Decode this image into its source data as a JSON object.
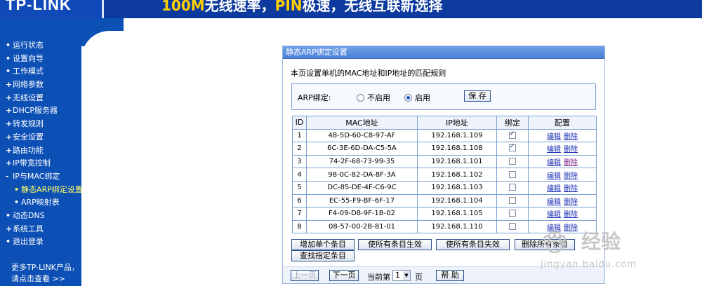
{
  "banner": {
    "logo": "TP-LINK",
    "slogan_a": "100M",
    "slogan_b": "无线速率，",
    "slogan_c": "PIN",
    "slogan_d": "极速，无线互联新选择"
  },
  "sidebar": {
    "items": [
      {
        "bullet": "•",
        "label": "运行状态"
      },
      {
        "bullet": "•",
        "label": "设置向导"
      },
      {
        "bullet": "•",
        "label": "工作模式"
      },
      {
        "bullet": "+",
        "label": "网络参数"
      },
      {
        "bullet": "+",
        "label": "无线设置"
      },
      {
        "bullet": "+",
        "label": "DHCP服务器"
      },
      {
        "bullet": "+",
        "label": "转发规则"
      },
      {
        "bullet": "+",
        "label": "安全设置"
      },
      {
        "bullet": "+",
        "label": "路由功能"
      },
      {
        "bullet": "+",
        "label": "IP带宽控制"
      },
      {
        "bullet": "-",
        "label": "IP与MAC绑定"
      },
      {
        "bullet": "•",
        "label": "静态ARP绑定设置"
      },
      {
        "bullet": "•",
        "label": "ARP映射表"
      },
      {
        "bullet": "•",
        "label": "动态DNS"
      },
      {
        "bullet": "+",
        "label": "系统工具"
      },
      {
        "bullet": "•",
        "label": "退出登录"
      }
    ],
    "promo_line1": "更多TP-LINK产品，",
    "promo_line2": "请点击查看 >>"
  },
  "panel": {
    "title": "静态ARP绑定设置",
    "description": "本页设置单机的MAC地址和IP地址的匹配规则",
    "arp_bind_label": "ARP绑定:",
    "radio_off": "不启用",
    "radio_on": "启用",
    "save_label": "保 存",
    "table": {
      "headers": [
        "ID",
        "MAC地址",
        "IP地址",
        "绑定",
        "配置"
      ],
      "edit_label": "编辑",
      "delete_label": "删除",
      "rows": [
        {
          "id": "1",
          "mac": "48-5D-60-C8-97-AF",
          "ip": "192.168.1.109",
          "bound": true
        },
        {
          "id": "2",
          "mac": "6C-3E-6D-DA-C5-5A",
          "ip": "192.168.1.108",
          "bound": true
        },
        {
          "id": "3",
          "mac": "74-2F-68-73-99-35",
          "ip": "192.168.1.101",
          "bound": false
        },
        {
          "id": "4",
          "mac": "98-0C-82-DA-8F-3A",
          "ip": "192.168.1.102",
          "bound": false
        },
        {
          "id": "5",
          "mac": "DC-85-DE-4F-C6-9C",
          "ip": "192.168.1.103",
          "bound": false
        },
        {
          "id": "6",
          "mac": "EC-55-F9-BF-6F-17",
          "ip": "192.168.1.104",
          "bound": false
        },
        {
          "id": "7",
          "mac": "F4-09-D8-9F-1B-02",
          "ip": "192.168.1.105",
          "bound": false
        },
        {
          "id": "8",
          "mac": "08-57-00-2B-81-01",
          "ip": "192.168.1.110",
          "bound": false
        }
      ]
    },
    "actions": {
      "add_single": "增加单个条目",
      "enable_all": "使所有条目生效",
      "disable_all": "使所有条目失效",
      "delete_all": "删除所有条目",
      "find": "查找指定条目"
    },
    "pager": {
      "prev": "上一页",
      "next": "下一页",
      "current_prefix": "当前第",
      "current_page": "1",
      "page_suffix": "页",
      "help": "帮 助"
    }
  },
  "watermark": {
    "brand": "经验",
    "url": "jingyan.baidu.com"
  }
}
